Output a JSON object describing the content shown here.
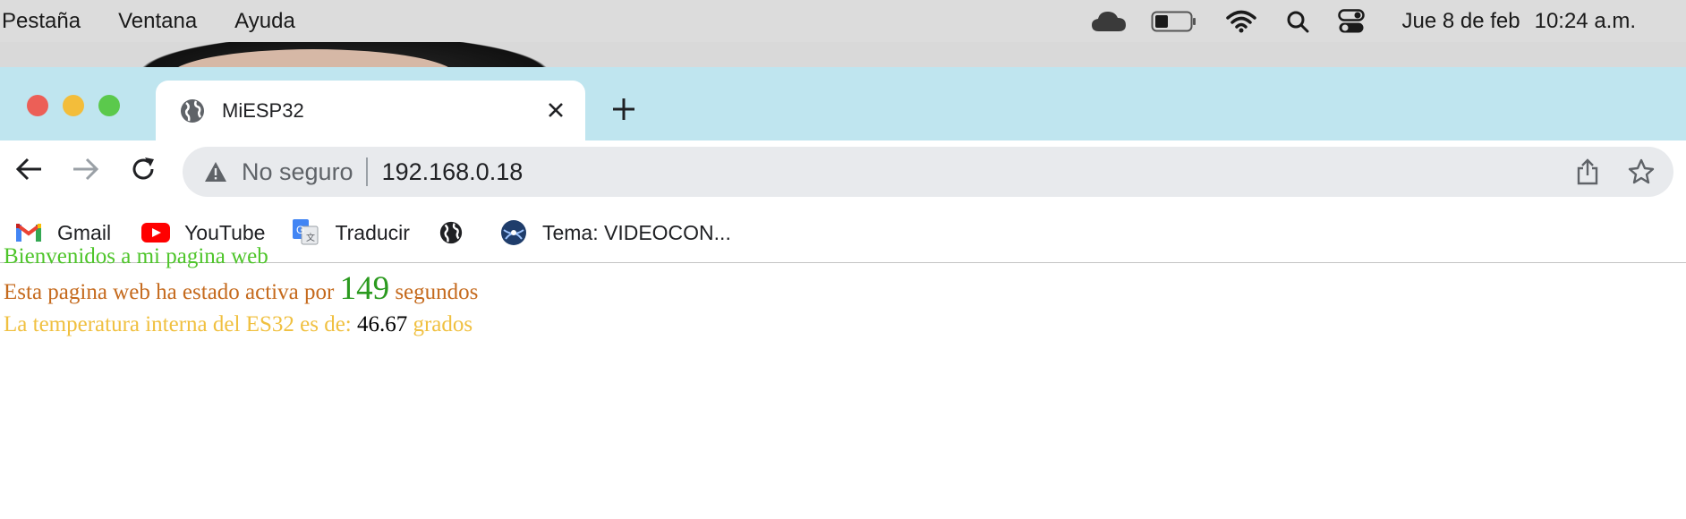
{
  "menubar": {
    "items": [
      "Pestaña",
      "Ventana",
      "Ayuda"
    ],
    "date": "Jue 8 de feb",
    "time": "10:24 a.m."
  },
  "browser": {
    "tab": {
      "title": "MiESP32",
      "favicon": "globe-icon"
    },
    "address": {
      "security_label": "No seguro",
      "url": "192.168.0.18"
    },
    "bookmarks": [
      {
        "label": "Gmail",
        "icon": "gmail-icon"
      },
      {
        "label": "YouTube",
        "icon": "youtube-icon"
      },
      {
        "label": "Traducir",
        "icon": "google-translate-icon"
      },
      {
        "label": "",
        "icon": "globe-icon"
      },
      {
        "label": "Tema: VIDEOCON...",
        "icon": "site-logo-icon"
      }
    ]
  },
  "page": {
    "welcome": "Bienvenidos a mi pagina web",
    "uptime_prefix": "Esta pagina web ha estado activa por",
    "uptime_value": "149",
    "uptime_suffix": "segundos",
    "temp_prefix": "La temperatura interna del ES32 es de:",
    "temp_value": "46.67",
    "temp_suffix": "grados"
  },
  "colors": {
    "tab_strip": "#bfe5ef",
    "welcome": "#4ec52a",
    "uptime_text": "#c56a1d",
    "uptime_value": "#2b9a1f",
    "temp_text": "#f0c040",
    "close_red": "#ec5f57",
    "minimize_yellow": "#f3bd3a",
    "maximize_green": "#5bc94c"
  }
}
